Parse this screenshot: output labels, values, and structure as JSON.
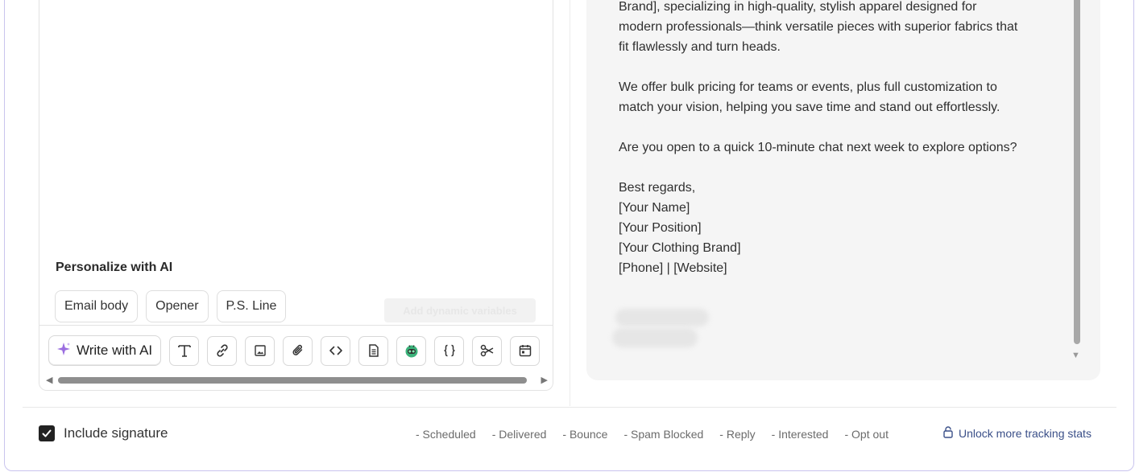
{
  "personalize": {
    "title": "Personalize with AI",
    "chips": [
      "Email body",
      "Opener",
      "P.S. Line"
    ],
    "add_variables": "Add dynamic variables"
  },
  "toolbar": {
    "write_ai": "Write with AI",
    "tools": [
      "text-format-icon",
      "link-icon",
      "image-icon",
      "attachment-icon",
      "code-icon",
      "document-icon",
      "robot-icon",
      "braces-icon",
      "scissors-icon",
      "calendar-icon"
    ],
    "ai_accent": "#9b6ee0",
    "robot_color": "#3bb27a"
  },
  "preview": {
    "lines": [
      "Brand], specializing in high-quality, stylish apparel designed for",
      "modern professionals—think versatile pieces with superior fabrics that",
      "fit flawlessly and turn heads.",
      "",
      "We offer bulk pricing for teams or events, plus full customization to",
      "match your vision, helping you save time and stand out effortlessly.",
      "",
      "Are you open to a quick 10-minute chat next week to explore options?",
      "",
      "Best regards,",
      "[Your Name]",
      "[Your Position]",
      "[Your Clothing Brand]",
      "[Phone] | [Website]"
    ]
  },
  "footer": {
    "include_signature": "Include signature",
    "signature_checked": true,
    "stats": [
      "- Scheduled",
      "- Delivered",
      "- Bounce",
      "- Spam Blocked",
      "- Reply",
      "- Interested",
      "- Opt out"
    ],
    "unlock": "Unlock more tracking stats"
  }
}
